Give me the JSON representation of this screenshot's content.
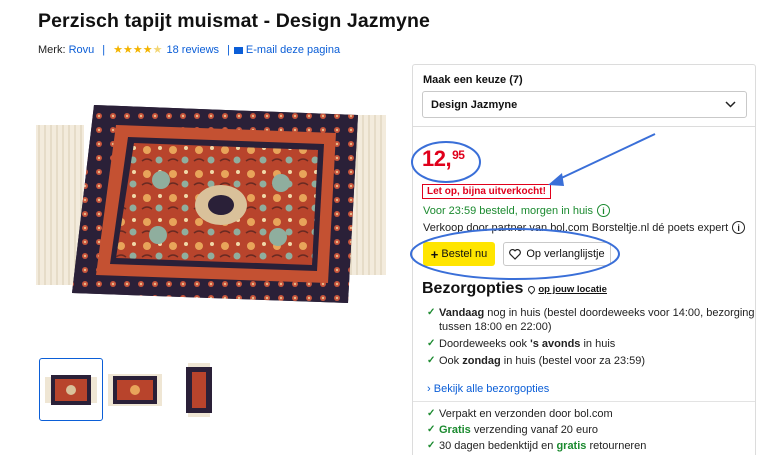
{
  "product": {
    "title": "Perzisch tapijt muismat - Design Jazmyne",
    "brand_prefix": "Merk:",
    "brand": "Rovu",
    "rating": 4.5,
    "reviews": "18 reviews",
    "email": "E-mail deze pagina"
  },
  "gallery": {
    "thumbnail_count": 3,
    "selected_index": 0
  },
  "buybox": {
    "choice_label": "Maak een keuze (7)",
    "choice_value": "Design Jazmyne",
    "price_whole": "12,",
    "price_cents": "95",
    "stock_warning": "Let op, bijna uitverkocht!",
    "delivery": "Voor 23:59 besteld, morgen in huis",
    "seller": "Verkoop door partner van bol.com Borsteltje.nl dé poets expert",
    "buy_label": "Bestel nu",
    "wishlist_label": "Op verlanglijstje"
  },
  "shipping": {
    "title": "Bezorgopties",
    "location": "op jouw locatie",
    "opt1_bold": "Vandaag",
    "opt1_rest": " nog in huis (bestel doordeweeks voor 14:00, bezorging",
    "opt1_line2": "tussen 18:00 en 22:00)",
    "opt2_pre": "Doordeweeks ook ",
    "opt2_bold": "'s avonds",
    "opt2_rest": " in huis",
    "opt3_pre": "Ook ",
    "opt3_bold": "zondag",
    "opt3_rest": " in huis (bestel voor za 23:59)",
    "all_link": "Bekijk alle bezorgopties"
  },
  "usps": {
    "u1": "Verpakt en verzonden door bol.com",
    "u2_bold": "Gratis",
    "u2_rest": " verzending vanaf 20 euro",
    "u3_pre": "30 dagen bedenktijd en ",
    "u3_bold": "gratis",
    "u3_rest": " retourneren"
  },
  "colors": {
    "price": "#e0001b",
    "link": "#0b5ed7",
    "delivery": "#1b8a2f",
    "buy_button": "#ffe500",
    "annotation": "#3a6fd8"
  }
}
